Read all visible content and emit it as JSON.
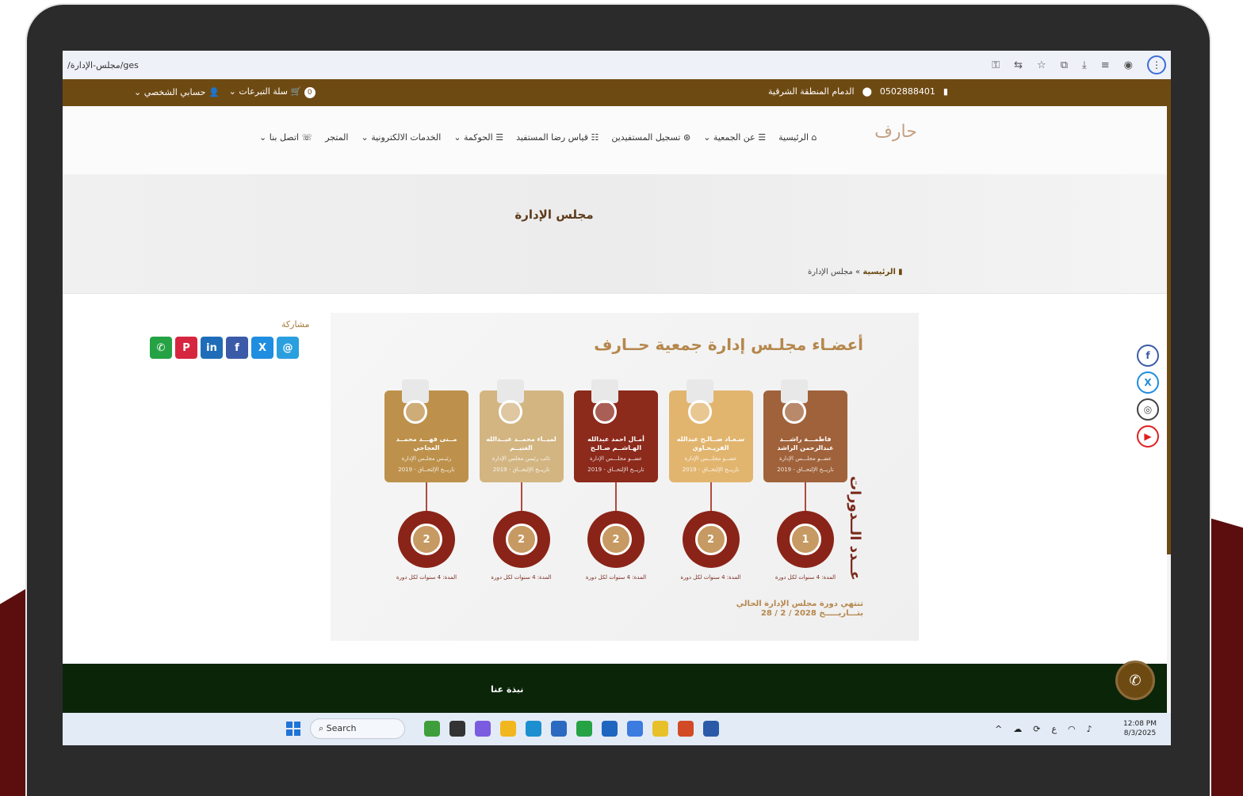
{
  "browser": {
    "url": "/مجلس-الإدارة/ges"
  },
  "topbar": {
    "phone": "0502888401",
    "location": "الدمام المنطقة الشرقية",
    "cart_count": "0",
    "cart_label": "سلة التبرعات",
    "account_label": "حسابي الشخصي"
  },
  "nav": {
    "items": [
      "الرئيسية",
      "عن الجمعية",
      "تسجيل المستفيدين",
      "قياس رضا المستفيد",
      "الحوكمة",
      "الخدمات الالكترونية",
      "المتجر",
      "اتصل بنا"
    ]
  },
  "hero": {
    "title": "مجلس الإدارة",
    "breadcrumb_home": "الرئيسية",
    "breadcrumb_sep": "»",
    "breadcrumb_current": "مجلس الإدارة"
  },
  "share": {
    "label": "مشاركة"
  },
  "poster": {
    "title": "أعضـاء مجلـس إدارة جمعية حــارف",
    "vertical_title": "عــدد الــدورات",
    "members": [
      {
        "name": "فاطمـــة راشـــد عبدالرحمن الراشد",
        "role": "عضــو مجلـــس الإدارة",
        "date": "تاريــخ الإلتحــاق - 2019",
        "cycles": "1",
        "color": "#a0623a"
      },
      {
        "name": "سـعـاد صــالـح عبدالله الفريـحـاوي",
        "role": "عضــو مجلـــس الإدارة",
        "date": "تاريــخ الإلتحــاق - 2019",
        "cycles": "2",
        "color": "#e2b56f"
      },
      {
        "name": "أمـال احمد عبدالله الهـاشــم صـالـح",
        "role": "عضــو مجلـــس الإدارة",
        "date": "تاريــخ الإلتحــاق - 2019",
        "cycles": "2",
        "color": "#8c2a1c"
      },
      {
        "name": "لميــاء محمــد عبــدالله الغنيــم",
        "role": "نائب رئيس مجلس الإدارة",
        "date": "تاريــخ الإلتحــاق - 2019",
        "cycles": "2",
        "color": "#d3b582"
      },
      {
        "name": "مــنى فهـــد محمــد العجاجي",
        "role": "رئيـس مجلـس الإدارة",
        "date": "تاريــخ الإلتحــاق - 2019",
        "cycles": "2",
        "color": "#bd914b"
      }
    ],
    "duration": "المدة: 4 سنوات لكل دورة",
    "end_line1": "تنتهي دورة مجلس الإدارة الحالي",
    "end_line2": "بتـــاريـــــخ 2028 / 2 / 28"
  },
  "footer": {
    "title": "نبذة عنا"
  },
  "taskbar": {
    "search_placeholder": "Search",
    "lang": "ع",
    "time": "12:08 PM",
    "date": "8/3/2025"
  }
}
